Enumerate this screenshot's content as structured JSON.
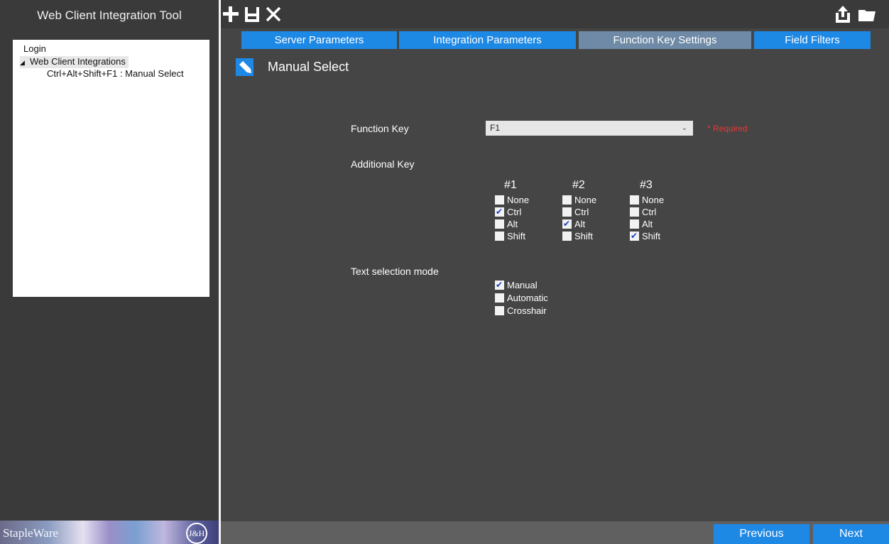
{
  "app_title": "Web Client Integration Tool",
  "tree": {
    "login": "Login",
    "web_client_integrations": "Web Client Integrations",
    "child": "Ctrl+Alt+Shift+F1 : Manual Select"
  },
  "toolbar": {
    "icons": [
      "add-icon",
      "save-icon",
      "close-icon",
      "export-icon",
      "folder-icon"
    ]
  },
  "tabs": [
    {
      "label": "Server Parameters",
      "active": false
    },
    {
      "label": "Integration Parameters",
      "active": false
    },
    {
      "label": "Function Key Settings",
      "active": true
    },
    {
      "label": "Field Filters",
      "active": false
    }
  ],
  "section": {
    "title": "Manual Select",
    "icon": "pencil-icon"
  },
  "form": {
    "function_key_label": "Function Key",
    "function_key_value": "F1",
    "required_text": "* Required",
    "additional_key_label": "Additional Key",
    "columns": [
      {
        "head": "#1",
        "options": [
          {
            "label": "None",
            "checked": false
          },
          {
            "label": "Ctrl",
            "checked": true
          },
          {
            "label": "Alt",
            "checked": false
          },
          {
            "label": "Shift",
            "checked": false
          }
        ]
      },
      {
        "head": "#2",
        "options": [
          {
            "label": "None",
            "checked": false
          },
          {
            "label": "Ctrl",
            "checked": false
          },
          {
            "label": "Alt",
            "checked": true
          },
          {
            "label": "Shift",
            "checked": false
          }
        ]
      },
      {
        "head": "#3",
        "options": [
          {
            "label": "None",
            "checked": false
          },
          {
            "label": "Ctrl",
            "checked": false
          },
          {
            "label": "Alt",
            "checked": false
          },
          {
            "label": "Shift",
            "checked": true
          }
        ]
      }
    ],
    "text_selection_label": "Text selection mode",
    "text_selection_options": [
      {
        "label": "Manual",
        "checked": true
      },
      {
        "label": "Automatic",
        "checked": false
      },
      {
        "label": "Crosshair",
        "checked": false
      }
    ]
  },
  "footer": {
    "logo_text": "StapleWare",
    "badge_text": "J&H",
    "previous_label": "Previous",
    "next_label": "Next"
  },
  "colors": {
    "accent": "#1e88e5",
    "active_tab": "#6e8aa6",
    "required": "#e53935"
  }
}
